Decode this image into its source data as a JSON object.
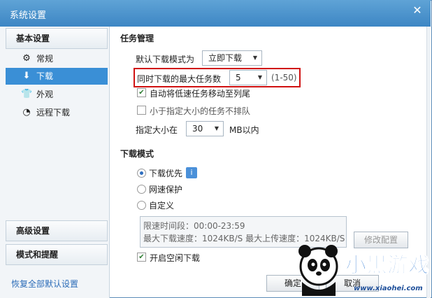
{
  "window": {
    "title": "系统设置",
    "close_glyph": "✕"
  },
  "sidebar": {
    "basic_header": "基本设置",
    "items": [
      {
        "label": "常规",
        "icon": "gear-icon"
      },
      {
        "label": "下载",
        "icon": "download-icon"
      },
      {
        "label": "外观",
        "icon": "shirt-icon"
      },
      {
        "label": "远程下载",
        "icon": "remote-icon"
      }
    ],
    "advanced_header": "高级设置",
    "mode_header": "模式和提醒",
    "reset_link": "恢复全部默认设置"
  },
  "task": {
    "heading": "任务管理",
    "default_mode_label": "默认下载模式为",
    "default_mode_value": "立即下载",
    "max_tasks_label": "同时下载的最大任务数",
    "max_tasks_value": "5",
    "max_tasks_range": "(1-50)",
    "move_slow_label": "自动将低速任务移动至列尾",
    "move_slow_checked": true,
    "no_queue_small_label": "小于指定大小的任务不排队",
    "no_queue_small_checked": false,
    "size_label": "指定大小在",
    "size_value": "30",
    "size_unit": "MB以内"
  },
  "download_mode": {
    "heading": "下载模式",
    "options": [
      {
        "label": "下载优先",
        "selected": true
      },
      {
        "label": "网速保护",
        "selected": false
      },
      {
        "label": "自定义",
        "selected": false
      }
    ],
    "info_line1": "限速时间段：00:00-23:59",
    "info_line2": "最大下载速度：1024KB/S  最大上传速度：1024KB/S",
    "modify_button": "修改配置",
    "idle_label": "开启空闲下载",
    "idle_checked": true
  },
  "footer": {
    "ok_button": "确定",
    "cancel_button": "取消"
  },
  "watermark": {
    "brand": "小黑游戏",
    "url": "www.xiaohei.com"
  }
}
